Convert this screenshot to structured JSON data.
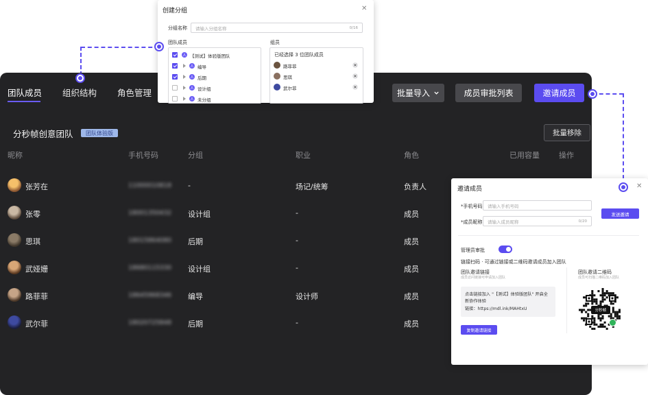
{
  "tabs": [
    "团队成员",
    "组织结构",
    "角色管理"
  ],
  "header_buttons": {
    "import": "批量导入",
    "approval": "成员审批列表",
    "invite": "邀请成员"
  },
  "team": {
    "name": "分秒帧创意团队",
    "badge": "团队体验版",
    "batch_remove": "批量移除"
  },
  "columns": [
    "昵称",
    "手机号码",
    "分组",
    "职业",
    "角色",
    "已用容量",
    "操作"
  ],
  "members": [
    {
      "name": "张芳在",
      "phone": "11000010818",
      "group": "-",
      "job": "场记/统筹",
      "role": "负责人"
    },
    {
      "name": "张零",
      "phone": "18001350432",
      "group": "设计组",
      "job": "-",
      "role": "成员"
    },
    {
      "name": "思琪",
      "phone": "18015864080",
      "group": "后期",
      "job": "-",
      "role": "成员"
    },
    {
      "name": "武娅姗",
      "phone": "18680115330",
      "group": "设计组",
      "job": "-",
      "role": "成员"
    },
    {
      "name": "路菲菲",
      "phone": "18645968346",
      "group": "编导",
      "job": "设计师",
      "role": "成员"
    },
    {
      "name": "武尔菲",
      "phone": "18020725848",
      "group": "后期",
      "job": "-",
      "role": "成员"
    }
  ],
  "create_group": {
    "title": "创建分组",
    "name_label": "分组名称",
    "name_placeholder": "请输入分组名称",
    "name_count": "0/16",
    "team_members_label": "团队成员",
    "tree": [
      {
        "label": "【测试】体验版团队",
        "checked": true,
        "root": true
      },
      {
        "label": "编导",
        "checked": true
      },
      {
        "label": "后期",
        "checked": true
      },
      {
        "label": "设计组",
        "checked": false
      },
      {
        "label": "未分组",
        "checked": false
      }
    ],
    "members_label": "组员",
    "selected_text": "已经选择 3 位团队成员",
    "selected": [
      "路菲菲",
      "思琪",
      "武尔菲"
    ]
  },
  "invite": {
    "title": "邀请成员",
    "phone_label": "*手机号码",
    "phone_placeholder": "请输入手机号码",
    "nick_label": "*成员昵称",
    "nick_placeholder": "请输入成员昵称",
    "nick_count": "0/20",
    "send_button": "发送邀请",
    "approval_label": "管理员审批",
    "link_desc": "链接扫码 · 可通过链接或二维码邀请成员加入团队",
    "link_title": "团队邀请链接",
    "link_sub": "成员访问链接可申请加入团队",
    "link_text": "点击链接加入 \"【测试】体验版团队\" 开启全新协作体验",
    "link_url": "链接：https://mdl.ink/MAHtxU",
    "copy_button": "复制邀请链接",
    "qr_title": "团队邀请二维码",
    "qr_sub": "成员可扫描二维码加入团队",
    "qr_logo": "分秒帧"
  },
  "colors": {
    "accent": "#5b4cf0",
    "background": "#232325"
  }
}
